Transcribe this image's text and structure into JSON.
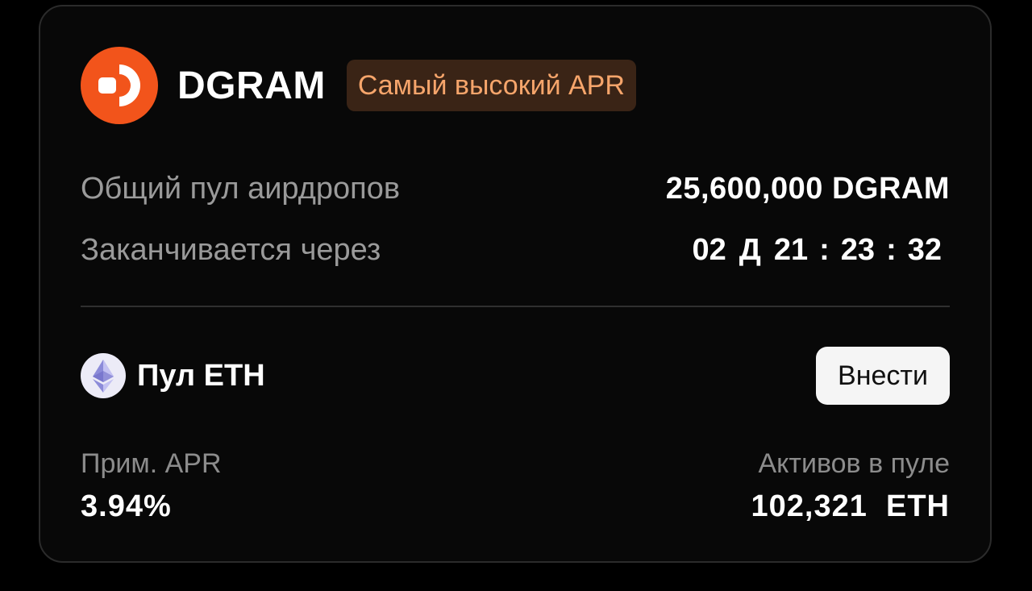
{
  "project": {
    "logo_icon": "dgram-logo-icon",
    "name": "DGRAM",
    "badge": "Самый высокий APR",
    "brand_color": "#f2541b",
    "badge_text_color": "#f6a56b",
    "badge_bg_color": "#3a2416"
  },
  "airdrop": {
    "pool_label": "Общий пул аирдропов",
    "pool_value": "25,600,000 DGRAM",
    "ends_label": "Заканчивается через",
    "countdown": {
      "days": "02",
      "days_unit": "Д",
      "hours": "21",
      "minutes": "23",
      "seconds": "32",
      "separator": ":"
    }
  },
  "pool": {
    "icon": "eth-icon",
    "name": "Пул ETH",
    "deposit_label": "Внести",
    "apr_label": "Прим. APR",
    "apr_value": "3.94%",
    "assets_label": "Активов в пуле",
    "assets_value": "102,321  ETH"
  }
}
